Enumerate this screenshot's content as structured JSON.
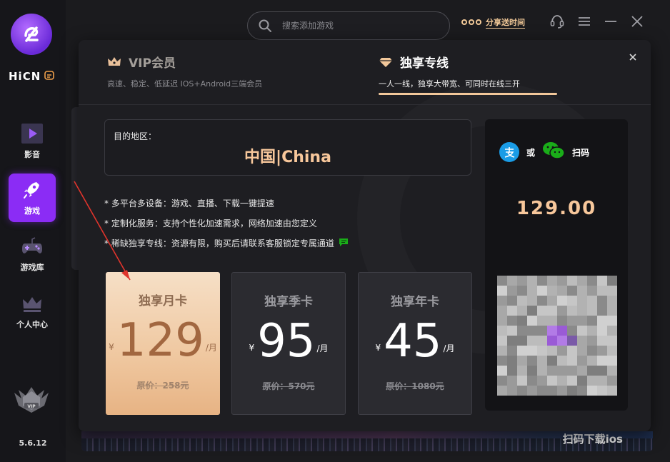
{
  "app": {
    "brand": "HiCN",
    "version": "5.6.12"
  },
  "sidebar": {
    "items": [
      {
        "label": "影音",
        "icon": "play-icon",
        "active": false
      },
      {
        "label": "游戏",
        "icon": "rocket-icon",
        "active": true
      },
      {
        "label": "游戏库",
        "icon": "gamepad-icon",
        "active": false
      },
      {
        "label": "个人中心",
        "icon": "crown-icon",
        "active": false
      }
    ],
    "vip_badge": "VIP"
  },
  "topbar": {
    "search_placeholder": "搜索添加游戏",
    "share_label": "分享送时间"
  },
  "background": {
    "banner_text": "扫码下载ios"
  },
  "modal": {
    "tabs": [
      {
        "title": "VIP会员",
        "subtitle": "高速、稳定、低延迟 IOS+Android三端会员",
        "active": false
      },
      {
        "title": "独享专线",
        "subtitle": "一人一线，独享大带宽、可同时在线三开",
        "active": true
      }
    ],
    "destination": {
      "label": "目的地区：",
      "value": "中国|China"
    },
    "features": [
      "* 多平台多设备：游戏、直播、下载一键提速",
      "* 定制化服务：支持个性化加速需求，网络加速由您定义",
      "* 稀缺独享专线：资源有限，购买后请联系客服锁定专属通道"
    ],
    "plans": [
      {
        "name": "独享月卡",
        "currency": "¥",
        "price": "129",
        "unit": "/月",
        "original": "原价：258元",
        "selected": true
      },
      {
        "name": "独享季卡",
        "currency": "¥",
        "price": "95",
        "unit": "/月",
        "original": "原价：570元",
        "selected": false
      },
      {
        "name": "独享年卡",
        "currency": "¥",
        "price": "45",
        "unit": "/月",
        "original": "原价：1080元",
        "selected": false
      }
    ],
    "payment": {
      "or_text": "或",
      "scan_text": "扫码",
      "amount": "129.00",
      "methods": [
        "alipay-icon",
        "wechat-pay-icon"
      ]
    }
  },
  "colors": {
    "accent_purple": "#8b2cf5",
    "gold": "#f7c79b",
    "selected_card": "#efc79f",
    "alipay_blue": "#1a9ce6",
    "wechat_green": "#1aad19"
  }
}
